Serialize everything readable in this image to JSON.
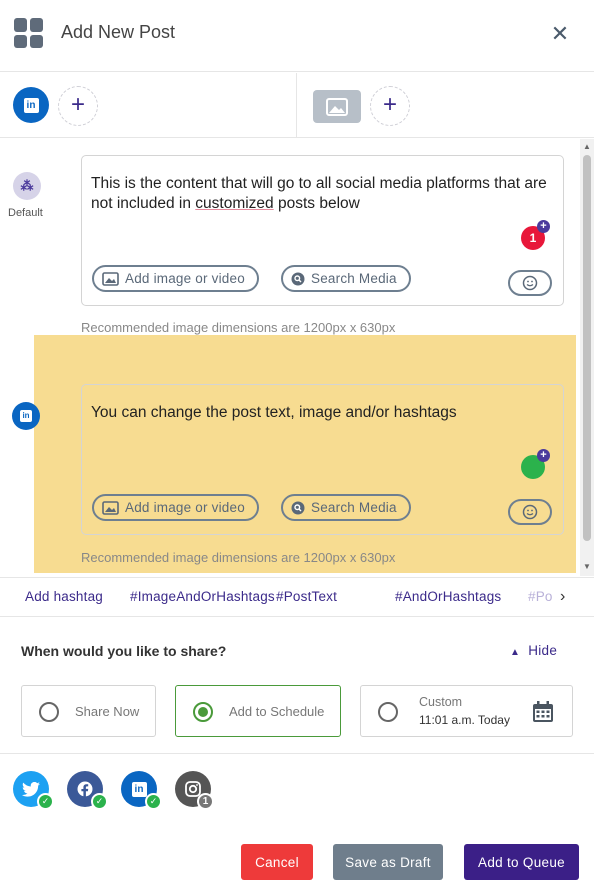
{
  "header": {
    "title": "Add New Post",
    "close_icon": "close-icon",
    "app_icon": "grid-icon"
  },
  "tabs": {
    "left": {
      "active_network": "linkedin-icon",
      "add_label": "+"
    },
    "right": {
      "image_tab": "image-icon",
      "add_label": "+"
    }
  },
  "default_post": {
    "label": "Default",
    "text_before": "This is the content that will go to all social media platforms that are not included in ",
    "text_underlined": "customized",
    "text_after": " posts below",
    "add_media_label": "Add image or video",
    "search_media_label": "Search Media",
    "badge_count": "1",
    "badge_plus": "+",
    "badge_color": "#e8173a",
    "recommendation": "Recommended image dimensions are 1200px x 630px"
  },
  "linkedin_post": {
    "text": "You can change the post text, image and/or hashtags",
    "add_media_label": "Add image or video",
    "search_media_label": "Search Media",
    "badge_plus": "+",
    "badge_color": "#2bb24c",
    "highlight_color": "#f7dc91",
    "recommendation": "Recommended image dimensions are 1200px x 630px"
  },
  "hashtags": {
    "add_label": "Add hashtag",
    "tags": [
      "#ImageAndOrHashtags",
      "#PostText",
      "#AndOrHashtags",
      "#Po"
    ],
    "next_label": "›"
  },
  "share": {
    "question": "When would you like to share?",
    "hide_label": "Hide",
    "options": {
      "now": "Share Now",
      "schedule": "Add to Schedule",
      "custom_title": "Custom",
      "custom_time": "11:01 a.m. Today"
    },
    "selected": "Add to Schedule"
  },
  "networks": [
    {
      "name": "twitter-icon",
      "status": "check",
      "color": "#1da1f2"
    },
    {
      "name": "facebook-icon",
      "status": "check",
      "color": "#3b5998"
    },
    {
      "name": "linkedin-icon",
      "status": "check",
      "color": "#0a66c2"
    },
    {
      "name": "instagram-icon",
      "status": "1",
      "color": "#555555"
    }
  ],
  "actions": {
    "cancel": "Cancel",
    "draft": "Save as Draft",
    "queue": "Add to Queue",
    "colors": {
      "cancel": "#ee3a3a",
      "draft": "#6f7e8c",
      "queue": "#3b1f87"
    }
  }
}
